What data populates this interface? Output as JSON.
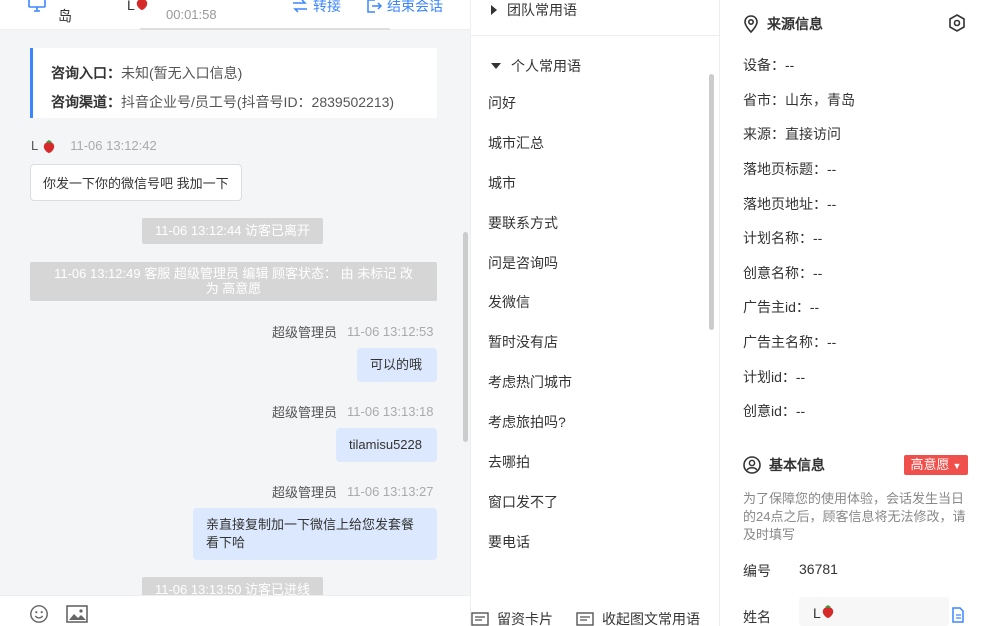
{
  "header": {
    "name": "岛",
    "visitor_name": "L",
    "timer": "00:01:58",
    "transfer_label": "转接",
    "end_label": "结束会话"
  },
  "entry": {
    "entrance_label": "咨询入口：",
    "entrance_value": "未知(暂无入口信息)",
    "channel_label": "咨询渠道：",
    "channel_value": "抖音企业号/员工号(抖音号ID：2839502213)"
  },
  "messages": [
    {
      "sender": "L",
      "time": "11-06 13:12:42",
      "text": "你发一下你的微信号吧 我加一下"
    },
    {
      "system": "11-06 13:12:44 访客已离开"
    },
    {
      "system": "11-06 13:12:49 客服 超级管理员 编辑 顾客状态：  由 未标记 改为 高意愿"
    },
    {
      "sender": "超级管理员",
      "time": "11-06 13:12:53",
      "text": "可以的哦"
    },
    {
      "sender": "超级管理员",
      "time": "11-06 13:13:18",
      "text": "tilamisu5228"
    },
    {
      "sender": "超级管理员",
      "time": "11-06 13:13:27",
      "text": "亲直接复制加一下微信上给您发套餐看下哈"
    },
    {
      "system": "11-06 13:13:50 访客已进线"
    }
  ],
  "footer": {
    "emoji_icon": "smile-icon",
    "image_icon": "image-icon"
  },
  "phrases": {
    "team_group": "团队常用语",
    "personal_group": "个人常用语",
    "items": [
      "问好",
      "城市汇总",
      "城市",
      "要联系方式",
      "问是咨询吗",
      "发微信",
      "暂时没有店",
      "考虑热门城市",
      "考虑旅拍吗?",
      "去哪拍",
      "窗口发不了",
      "要电话"
    ],
    "card_btn": "留资卡片",
    "collapse_btn": "收起图文常用语"
  },
  "source": {
    "title": "来源信息",
    "rows": [
      "设备：--",
      "省市：山东，青岛",
      "来源：直接访问",
      "落地页标题：--",
      "落地页地址：--",
      "计划名称：--",
      "创意名称：--",
      "广告主id：--",
      "广告主名称：--",
      "计划id：--",
      "创意id：--"
    ]
  },
  "basic": {
    "title": "基本信息",
    "intent_tag": "高意愿",
    "notice": "为了保障您的使用体验，会话发生当日的24点之后，顾客信息将无法修改，请及时填写",
    "id_label": "编号",
    "id_value": "36781",
    "name_label": "姓名",
    "name_value": "L"
  },
  "colors": {
    "accent": "#3b86ff",
    "bubble": "#dbe8fd",
    "tag": "#f0504b"
  }
}
